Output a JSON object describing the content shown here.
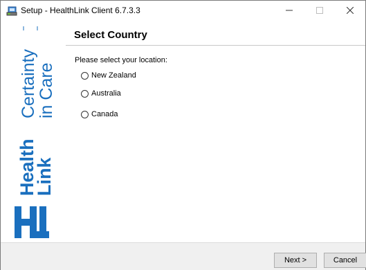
{
  "window": {
    "title": "Setup - HealthLink Client 6.7.3.3",
    "minimize_glyph": "—",
    "maximize_glyph": "☐",
    "close_glyph": "✕"
  },
  "brand": {
    "tagline_line1": "Certainty",
    "tagline_line2": "in Care",
    "name_line1": "Health",
    "name_line2": "Link",
    "color": "#1a6fbe"
  },
  "page": {
    "heading": "Select Country",
    "prompt": "Please select your location:"
  },
  "options": [
    {
      "label": "New Zealand",
      "selected": false
    },
    {
      "label": "Australia",
      "selected": false
    },
    {
      "label": "Canada",
      "selected": false
    }
  ],
  "buttons": {
    "next": "Next >",
    "cancel": "Cancel"
  },
  "icons": {
    "app": "setup-computer-icon",
    "minimize": "minimize-icon",
    "maximize": "maximize-icon",
    "close": "close-icon",
    "logo": "healthlink-hl-logo"
  }
}
